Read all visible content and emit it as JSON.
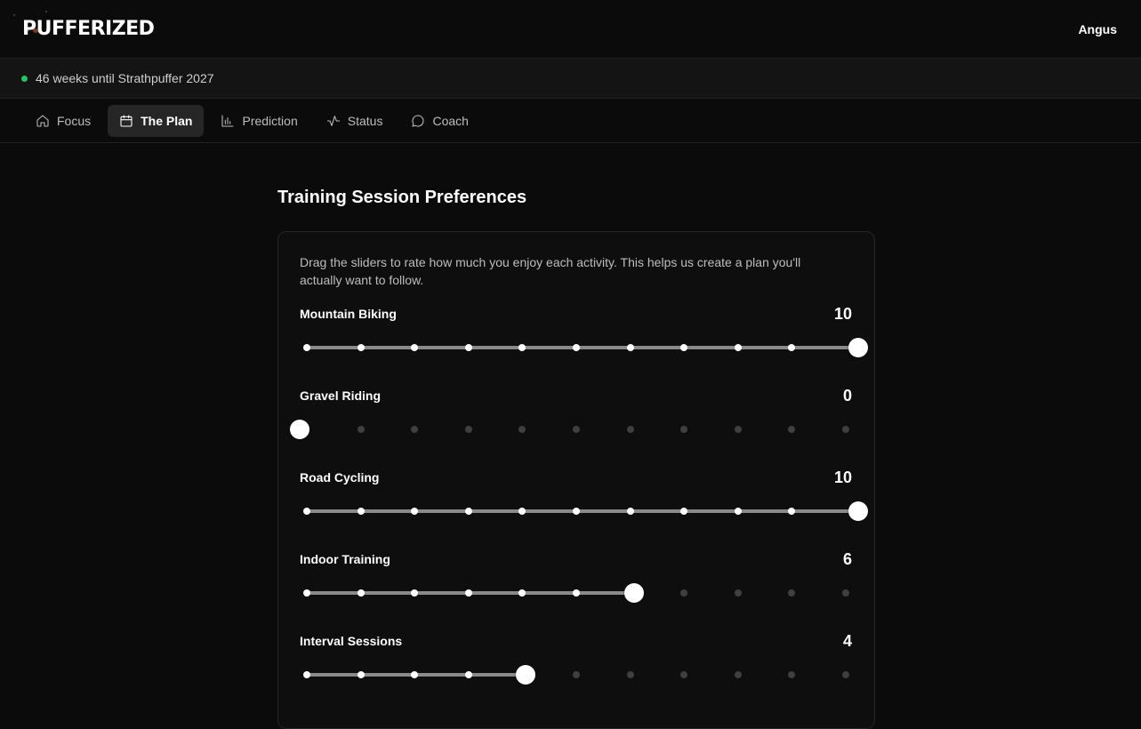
{
  "app": {
    "logo": "PUFFERIZED",
    "user": "Angus"
  },
  "countdown": {
    "text": "46 weeks until Strathpuffer 2027",
    "status_color": "#22c55e"
  },
  "tabs": [
    {
      "label": "Focus",
      "icon": "home-icon",
      "active": false
    },
    {
      "label": "The Plan",
      "icon": "calendar-icon",
      "active": true
    },
    {
      "label": "Prediction",
      "icon": "bar-chart-icon",
      "active": false
    },
    {
      "label": "Status",
      "icon": "activity-icon",
      "active": false
    },
    {
      "label": "Coach",
      "icon": "message-icon",
      "active": false
    }
  ],
  "main": {
    "title": "Training Session Preferences",
    "intro": "Drag the sliders to rate how much you enjoy each activity. This helps us create a plan you'll actually want to follow.",
    "slider_min": 0,
    "slider_max": 10,
    "preferences": [
      {
        "label": "Mountain Biking",
        "value": 10
      },
      {
        "label": "Gravel Riding",
        "value": 0
      },
      {
        "label": "Road Cycling",
        "value": 10
      },
      {
        "label": "Indoor Training",
        "value": 6
      },
      {
        "label": "Interval Sessions",
        "value": 4
      }
    ]
  }
}
